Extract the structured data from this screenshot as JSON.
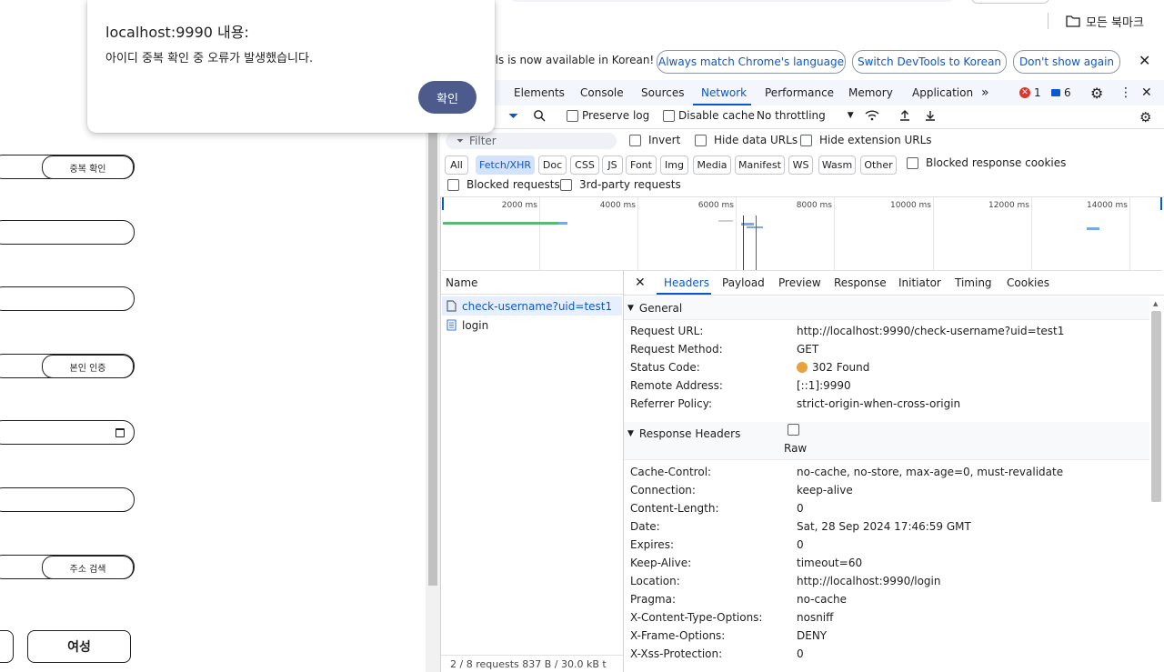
{
  "browser": {
    "bookmarks_label": "모든 북마크"
  },
  "dialog": {
    "title": "localhost:9990 내용:",
    "message": "아이디 중복 확인 중 오류가 발생했습니다.",
    "ok_label": "확인"
  },
  "page": {
    "check_duplicate_label": "중복 확인",
    "verify_identity_label": "본인 인증",
    "address_search_label": "주소 검색",
    "gender_female_label": "여성"
  },
  "devtools": {
    "infobar": {
      "text": "ools is now available in Korean!",
      "match_language": "Always match Chrome's language",
      "switch_korean": "Switch DevTools to Korean",
      "dont_show": "Don't show again"
    },
    "tabs": [
      "Elements",
      "Console",
      "Sources",
      "Network",
      "Performance",
      "Memory",
      "Application"
    ],
    "active_tab": "Network",
    "errors_count": "1",
    "messages_count": "6",
    "toolbar": {
      "preserve_log": "Preserve log",
      "disable_cache": "Disable cache",
      "throttling": "No throttling"
    },
    "filter": {
      "placeholder": "Filter",
      "invert": "Invert",
      "hide_data_urls": "Hide data URLs",
      "hide_extension_urls": "Hide extension URLs",
      "types": [
        "All",
        "Fetch/XHR",
        "Doc",
        "CSS",
        "JS",
        "Font",
        "Img",
        "Media",
        "Manifest",
        "WS",
        "Wasm",
        "Other"
      ],
      "active_type": "Fetch/XHR",
      "blocked_response_cookies": "Blocked response cookies",
      "blocked_requests": "Blocked requests",
      "third_party": "3rd-party requests"
    },
    "timeline": {
      "ticks": [
        "2000 ms",
        "4000 ms",
        "6000 ms",
        "8000 ms",
        "10000 ms",
        "12000 ms",
        "14000 ms"
      ]
    },
    "requests": {
      "column_name": "Name",
      "rows": [
        "check-username?uid=test1",
        "login"
      ],
      "status_bar": "2 / 8 requests    837 B / 30.0 kB t"
    },
    "details": {
      "tabs": [
        "Headers",
        "Payload",
        "Preview",
        "Response",
        "Initiator",
        "Timing",
        "Cookies"
      ],
      "active_tab": "Headers",
      "general_title": "General",
      "general": [
        {
          "key": "Request URL:",
          "value": "http://localhost:9990/check-username?uid=test1"
        },
        {
          "key": "Request Method:",
          "value": "GET"
        },
        {
          "key": "Status Code:",
          "value": "302 Found"
        },
        {
          "key": "Remote Address:",
          "value": "[::1]:9990"
        },
        {
          "key": "Referrer Policy:",
          "value": "strict-origin-when-cross-origin"
        }
      ],
      "response_headers_title": "Response Headers",
      "raw_label": "Raw",
      "response_headers": [
        {
          "key": "Cache-Control:",
          "value": "no-cache, no-store, max-age=0, must-revalidate"
        },
        {
          "key": "Connection:",
          "value": "keep-alive"
        },
        {
          "key": "Content-Length:",
          "value": "0"
        },
        {
          "key": "Date:",
          "value": "Sat, 28 Sep 2024 17:46:59 GMT"
        },
        {
          "key": "Expires:",
          "value": "0"
        },
        {
          "key": "Keep-Alive:",
          "value": "timeout=60"
        },
        {
          "key": "Location:",
          "value": "http://localhost:9990/login"
        },
        {
          "key": "Pragma:",
          "value": "no-cache"
        },
        {
          "key": "X-Content-Type-Options:",
          "value": "nosniff"
        },
        {
          "key": "X-Frame-Options:",
          "value": "DENY"
        },
        {
          "key": "X-Xss-Protection:",
          "value": "0"
        }
      ]
    },
    "colors": {
      "accent": "#0b57d0",
      "status_302": "#e8a33d",
      "dialog_button": "#4d5b8c"
    }
  }
}
